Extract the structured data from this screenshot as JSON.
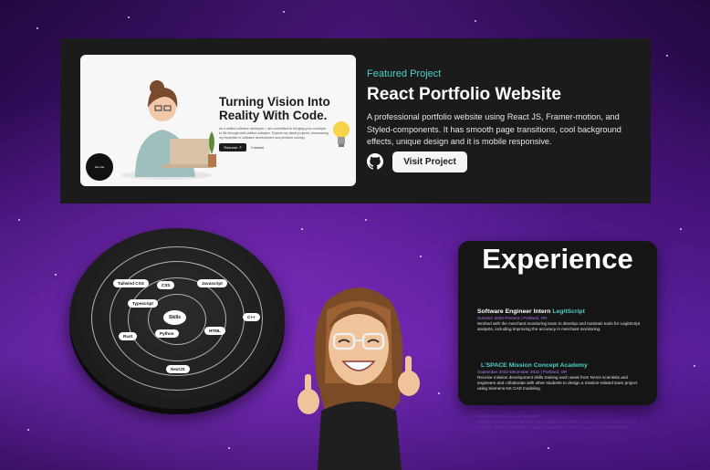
{
  "featured": {
    "label": "Featured Project",
    "title": "React Portfolio Website",
    "description": "A professional portfolio website using React JS, Framer-motion, and Styled-components. It has smooth page transitions, cool background effects, unique design and it is mobile responsive.",
    "visit_label": "Visit Project",
    "icon": "github-icon",
    "accent_color": "#4fd1c5"
  },
  "preview": {
    "headline": "Turning Vision Into Reality With Code.",
    "blurb": "As a skilled software developer, I am committed to bringing your concepts to life through well-crafted software. Explore my latest projects, showcasing my expertise in software development and problem solving.",
    "resume_label": "Resume ↗",
    "contact_label": "Contact",
    "badge_label": "Hire Me"
  },
  "skills": {
    "center": "Skills",
    "items": [
      "Tailwind CSS",
      "CSS",
      "Javascript",
      "Typescript",
      "HTML",
      "C++",
      "Python",
      "Rust",
      "NextJS"
    ]
  },
  "experience": {
    "title": "Experience",
    "jobs": [
      {
        "role": "Software Engineer Intern ",
        "company": "LegitScript",
        "dates": "Summer 2023-Present | Portland, OR",
        "description": "Worked with the merchant monitoring team to develop and maintain tools for LegitScript analysts, including improving the accuracy in merchant monitoring."
      },
      {
        "role": "L'SPACE Mission Concept Academy",
        "company": "",
        "dates": "September 2022-December 2022 | Portland, OR",
        "description": "Receive mission development skills training each week from NASA scientists and engineers and collaborate with other students to design a mission-related team project using Siemens NX CAD modeling."
      }
    ]
  }
}
